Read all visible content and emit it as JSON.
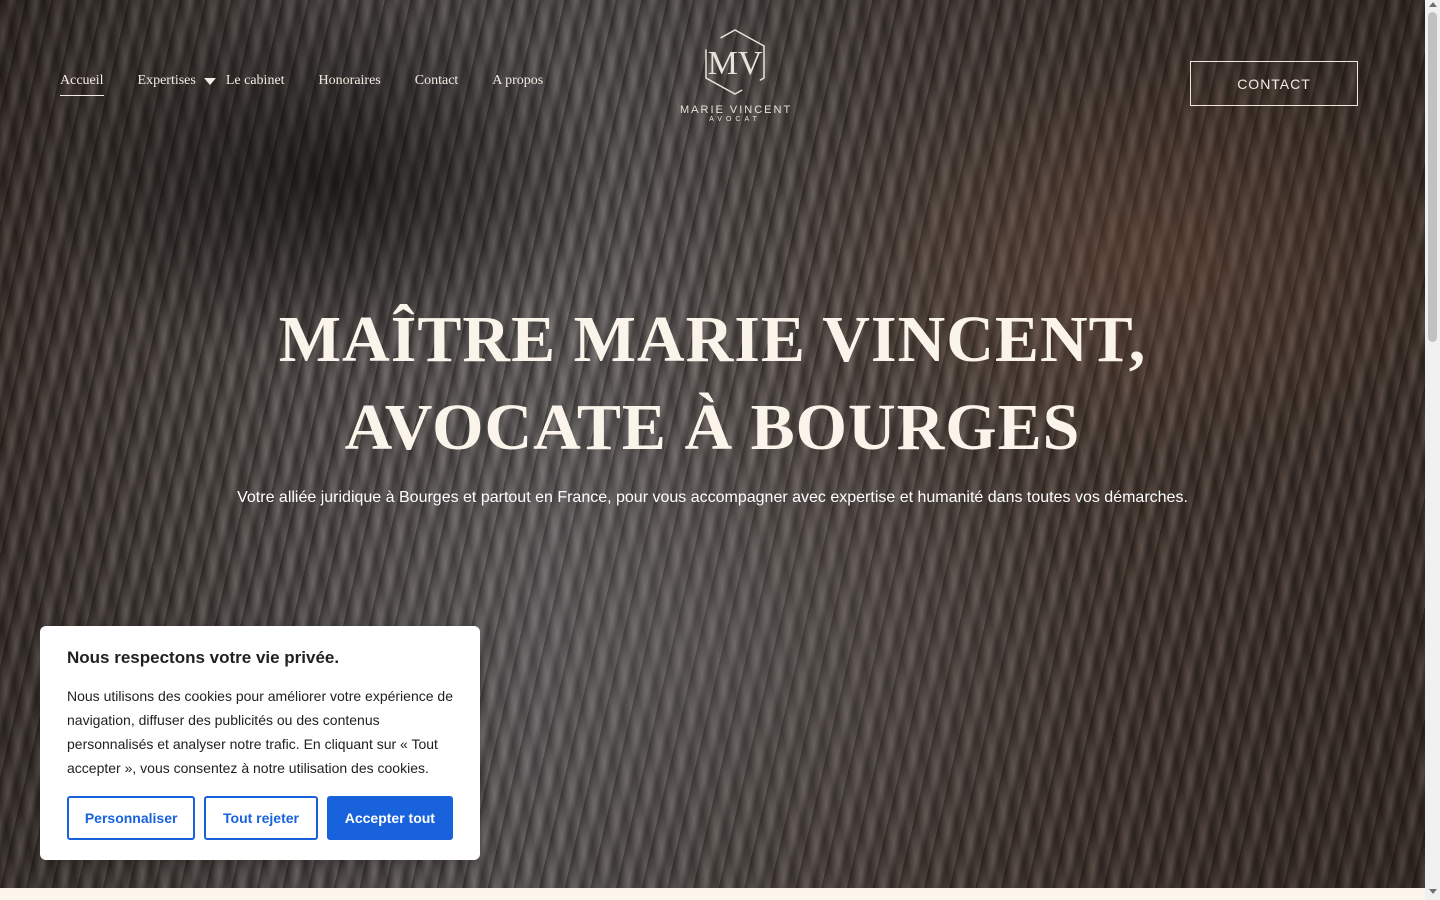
{
  "nav": {
    "items": [
      {
        "label": "Accueil",
        "active": true
      },
      {
        "label": "Expertises",
        "has_dropdown": true
      },
      {
        "label": "Le cabinet"
      },
      {
        "label": "Honoraires"
      },
      {
        "label": "Contact"
      },
      {
        "label": "A propos"
      }
    ]
  },
  "logo": {
    "monogram": "MV",
    "name": "MARIE VINCENT",
    "subtitle": "AVOCAT"
  },
  "header": {
    "contact_button": "CONTACT"
  },
  "hero": {
    "title_line1": "MAÎTRE MARIE VINCENT,",
    "title_line2": "AVOCATE À BOURGES",
    "subtitle": "Votre alliée juridique à Bourges et partout en France, pour vous accompagner avec expertise et humanité dans toutes vos démarches."
  },
  "cookie_banner": {
    "title": "Nous respectons votre vie privée.",
    "text": "Nous utilisons des cookies pour améliorer votre expérience de navigation, diffuser des publicités ou des contenus personnalisés et analyser notre trafic. En cliquant sur « Tout accepter », vous consentez à notre utilisation des cookies.",
    "customize_label": "Personnaliser",
    "reject_label": "Tout rejeter",
    "accept_label": "Accepter tout"
  },
  "colors": {
    "accent_blue": "#1863dc",
    "hero_text": "#fbf4ea",
    "page_bg": "#fdf6ec"
  }
}
